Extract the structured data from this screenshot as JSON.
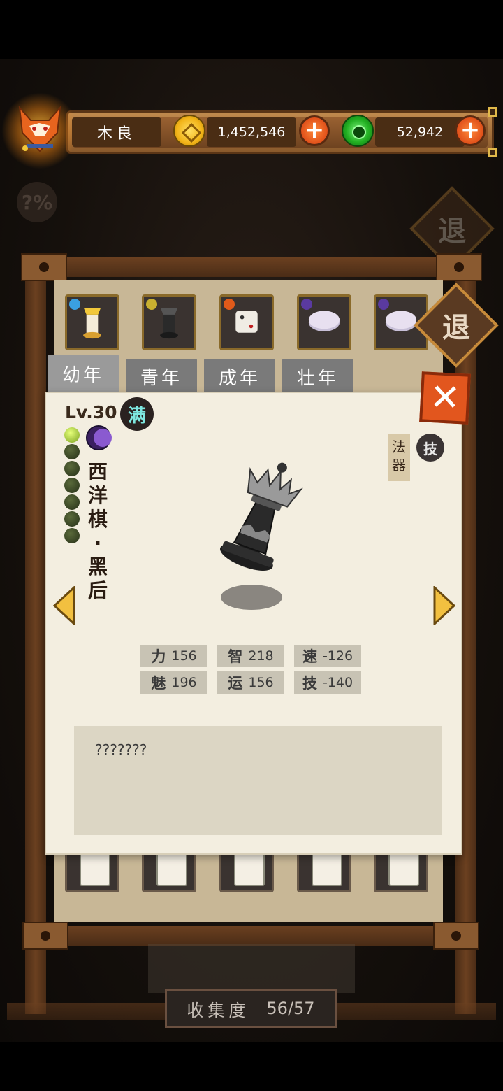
{
  "player": {
    "name": "木良"
  },
  "currency": {
    "coins": "1,452,546",
    "jade": "52,942",
    "plus_label": "+",
    "coin_icon": "gold-coin-icon",
    "jade_icon": "jade-disc-icon"
  },
  "help_icon": "?%",
  "exit_label": "退",
  "stage_tabs": [
    {
      "label": "幼年",
      "active": true
    },
    {
      "label": "青年",
      "active": false
    },
    {
      "label": "成年",
      "active": false
    },
    {
      "label": "壮年",
      "active": false
    }
  ],
  "item": {
    "level": "Lv.30",
    "max_badge": "满",
    "name_chars": [
      "西",
      "洋",
      "棋",
      "·",
      "黑",
      "后"
    ],
    "stars_total": 7,
    "stars_lit": 1,
    "category": "法器",
    "skill_badge": "技",
    "stats": [
      {
        "label": "力",
        "value": "156"
      },
      {
        "label": "智",
        "value": "218"
      },
      {
        "label": "速",
        "value": "-126"
      },
      {
        "label": "魅",
        "value": "196"
      },
      {
        "label": "运",
        "value": "156"
      },
      {
        "label": "技",
        "value": "-140"
      }
    ],
    "description": "???????"
  },
  "close_label": "✕",
  "collection": {
    "label": "收集度",
    "value": "56/57"
  },
  "colors": {
    "accent": "#e2561e",
    "parchment": "#f3eee0",
    "wood": "#6b4020"
  }
}
